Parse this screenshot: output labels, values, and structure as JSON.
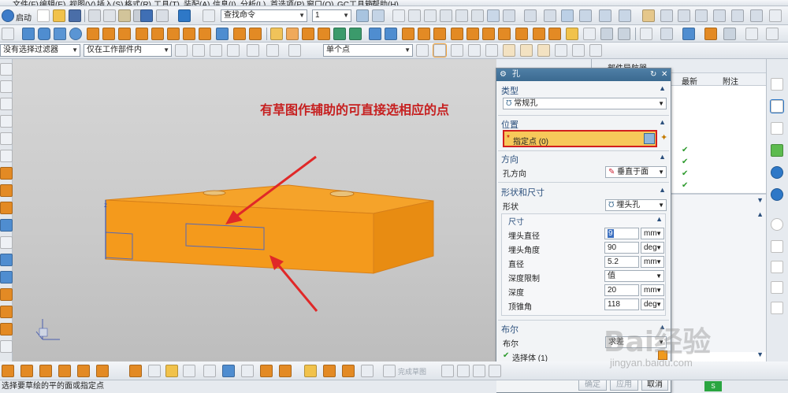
{
  "menu": [
    "文件(F)",
    "编辑(E)",
    "视图(V)",
    "插入(S)",
    "格式(R)",
    "工具(T)",
    "装配(A)",
    "信息(I)",
    "分析(L)",
    "首选项(P)",
    "窗口(O)",
    "GC工具箱",
    "帮助(H)"
  ],
  "toolbar1": {
    "start_label": "启动",
    "command_search_placeholder": "查找命令",
    "layer_value": "1"
  },
  "toolbar3": {
    "filter_value": "没有选择过滤器",
    "scope_value": "仅在工作部件内",
    "snap_value": "单个点"
  },
  "viewport": {
    "annotation": "有草图作辅助的可直接选相应的点",
    "arrow_color": "#e02828",
    "block_color": "#f29a1a"
  },
  "right_panel": {
    "title": "部件导航器",
    "col_latest": "最新",
    "col_note": "附注"
  },
  "dialog": {
    "title": "孔",
    "type_section": "类型",
    "type_value": "常规孔",
    "position_section": "位置",
    "specify_point": "指定点 (0)",
    "direction_section": "方向",
    "hole_direction_label": "孔方向",
    "hole_direction_value": "垂直于面",
    "shape_section": "形状和尺寸",
    "form_label": "形状",
    "form_value": "埋头孔",
    "dimensions_label": "尺寸",
    "params": [
      {
        "label": "埋头直径",
        "value": "9",
        "unit": "mm"
      },
      {
        "label": "埋头角度",
        "value": "90",
        "unit": "deg"
      },
      {
        "label": "直径",
        "value": "5.2",
        "unit": "mm"
      },
      {
        "label": "深度限制",
        "value": "值",
        "unit": ""
      },
      {
        "label": "深度",
        "value": "20",
        "unit": "mm"
      },
      {
        "label": "顶锥角",
        "value": "118",
        "unit": "deg"
      }
    ],
    "boolean_section": "布尔",
    "boolean_label": "布尔",
    "boolean_value": "求差",
    "select_body": "选择体 (1)",
    "ok": "确定",
    "apply": "应用",
    "cancel": "取消"
  },
  "bottom_toolbar": {
    "finish_sketch": "完成草图"
  },
  "status": "选择要草绘的平的面或指定点",
  "watermark": {
    "brand": "Bai经验",
    "url": "jingyan.baidu.com"
  }
}
